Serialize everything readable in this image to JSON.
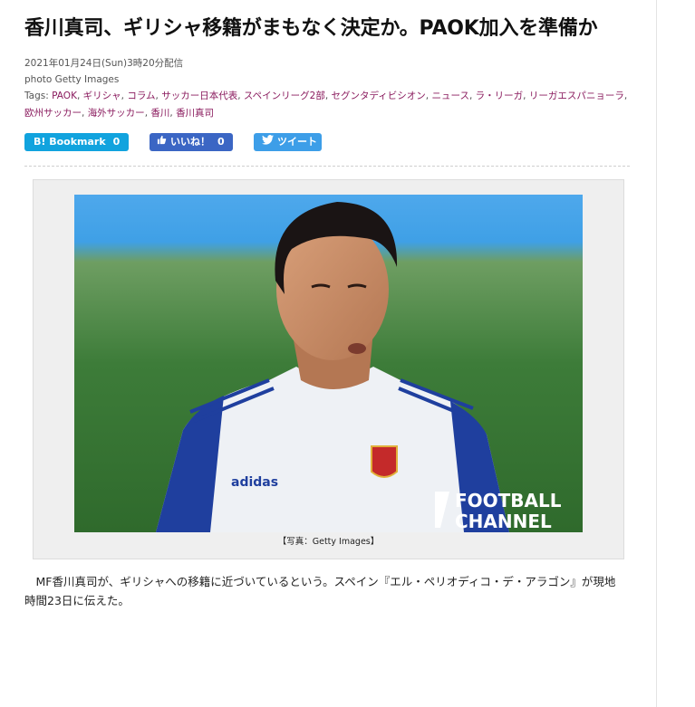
{
  "article": {
    "title": "香川真司、ギリシャ移籍がまもなく決定か。PAOK加入を準備か",
    "date": "2021年01月24日(Sun)3時20分配信",
    "photo_credit": "photo Getty Images",
    "tags_label": "Tags:",
    "tags": [
      "PAOK",
      "ギリシャ",
      "コラム",
      "サッカー日本代表",
      "スペインリーグ2部",
      "セグンタディビシオン",
      "ニュース",
      "ラ・リーガ",
      "リーガエスパニョーラ",
      "欧州サッカー",
      "海外サッカー",
      "香川",
      "香川真司"
    ],
    "image_caption": "【写真：Getty Images】",
    "image_watermark": [
      "FOOTBALL",
      "CHANNEL"
    ],
    "jersey_brand": "adidas",
    "body": "　MF香川真司が、ギリシャへの移籍に近づいているという。スペイン『エル・ペリオディコ・デ・アラゴン』が現地時間23日に伝えた。"
  },
  "share": {
    "hatena": {
      "label": "B! Bookmark",
      "count": "0",
      "color": "#11a3de"
    },
    "like": {
      "label": "いいね！",
      "count": "0",
      "color": "#3b66c4"
    },
    "tweet": {
      "label": "ツイート",
      "color": "#3d9ee8"
    }
  },
  "colors": {
    "tag_link": "#8a1b5e"
  }
}
